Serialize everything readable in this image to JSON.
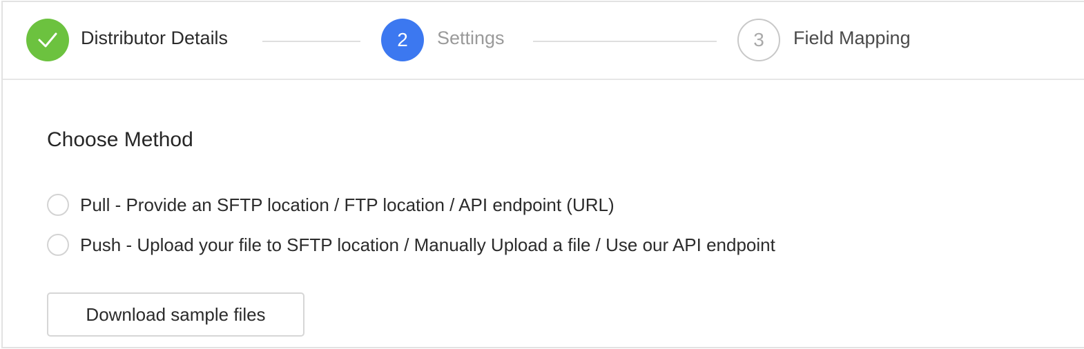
{
  "stepper": {
    "steps": [
      {
        "label": "Distributor Details",
        "status": "complete",
        "icon": "checkmark-icon",
        "number": ""
      },
      {
        "label": "Settings",
        "status": "active",
        "number": "2"
      },
      {
        "label": "Field Mapping",
        "status": "pending",
        "number": "3"
      }
    ]
  },
  "content": {
    "title": "Choose Method",
    "options": [
      {
        "label": "Pull - Provide an SFTP location / FTP location / API endpoint (URL)",
        "selected": false
      },
      {
        "label": "Push - Upload your file to SFTP location / Manually Upload a file / Use our API endpoint",
        "selected": false
      }
    ],
    "download_button": "Download sample files"
  },
  "colors": {
    "complete": "#6cc23f",
    "active": "#3c78f0",
    "pending_border": "#c8c8c8"
  }
}
